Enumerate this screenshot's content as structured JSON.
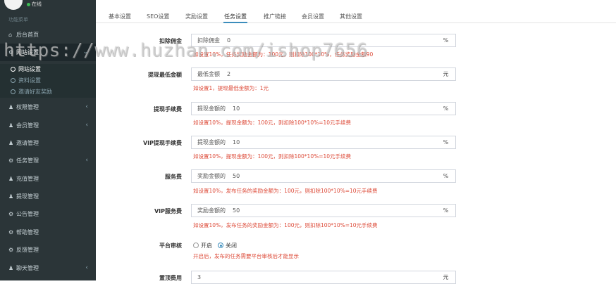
{
  "sidebar": {
    "status": "在线",
    "section_title": "功能菜单",
    "items": [
      {
        "label": "后台首页",
        "icon": "home-icon",
        "glyph": "⌂",
        "chevron": ""
      },
      {
        "label": "网站设置",
        "icon": "gears-icon",
        "glyph": "⚙",
        "chevron": "⌄"
      },
      {
        "label": "权限管理",
        "icon": "users-icon",
        "glyph": "♟",
        "chevron": "‹"
      },
      {
        "label": "会员管理",
        "icon": "users-icon",
        "glyph": "♟",
        "chevron": "‹"
      },
      {
        "label": "邀请管理",
        "icon": "users-icon",
        "glyph": "♟",
        "chevron": ""
      },
      {
        "label": "任务管理",
        "icon": "gears-icon",
        "glyph": "⚙",
        "chevron": "‹"
      },
      {
        "label": "充值管理",
        "icon": "users-icon",
        "glyph": "♟",
        "chevron": ""
      },
      {
        "label": "提现管理",
        "icon": "users-icon",
        "glyph": "♟",
        "chevron": ""
      },
      {
        "label": "公告管理",
        "icon": "gears-icon",
        "glyph": "⚙",
        "chevron": ""
      },
      {
        "label": "帮助管理",
        "icon": "gears-icon",
        "glyph": "⚙",
        "chevron": ""
      },
      {
        "label": "反馈管理",
        "icon": "gears-icon",
        "glyph": "⚙",
        "chevron": ""
      },
      {
        "label": "聊天管理",
        "icon": "users-icon",
        "glyph": "♟",
        "chevron": "‹"
      }
    ],
    "subitems": [
      {
        "label": "网站设置",
        "icon": "circle-icon"
      },
      {
        "label": "资料设置",
        "icon": "circle-icon"
      },
      {
        "label": "邀请好友奖励",
        "icon": "user-circle-icon"
      }
    ]
  },
  "tabs": [
    "基本设置",
    "SEO设置",
    "奖励设置",
    "任务设置",
    "推广链接",
    "会员设置",
    "其他设置"
  ],
  "active_tab": "任务设置",
  "form": {
    "rows": [
      {
        "label": "扣除佣金",
        "prefix": "扣除佣金",
        "value": "0",
        "unit": "%",
        "hint": "如设置10%，任务奖励金额为：100元，则扣除100*10%，任务奖励金额90"
      },
      {
        "label": "提现最低金额",
        "prefix": "最低金额",
        "value": "2",
        "unit": "元",
        "hint": "如设置1，提现最低金额为：1元"
      },
      {
        "label": "提现手续费",
        "prefix": "提现金额的",
        "value": "10",
        "unit": "%",
        "hint": "如设置10%，提现金额为：100元，则扣除100*10%=10元手续费"
      },
      {
        "label": "VIP提现手续费",
        "prefix": "提现金额的",
        "value": "10",
        "unit": "%",
        "hint": "如设置10%，提现金额为：100元，则扣除100*10%=10元手续费"
      },
      {
        "label": "服务费",
        "prefix": "奖励金额的",
        "value": "50",
        "unit": "%",
        "hint": "如设置10%，发布任务的奖励金额为：100元，则扣除100*10%=10元手续费"
      },
      {
        "label": "VIP服务费",
        "prefix": "奖励金额的",
        "value": "50",
        "unit": "%",
        "hint": "如设置10%，发布任务的奖励金额为：100元，则扣除100*10%=10元手续费"
      }
    ],
    "audit": {
      "label": "平台审核",
      "option_on": "开启",
      "option_off": "关闭",
      "selected": "关闭",
      "hint": "开启后，发布的任务需要平台审核后才能显示"
    },
    "top_fee": {
      "label": "置顶费用",
      "value": "3",
      "unit": "元"
    }
  },
  "watermark": "https://www.huzhan.com/ishop7656",
  "colors": {
    "sidebar_bg": "#2b3538",
    "accent": "#3c8dbc",
    "hint": "#dd4b39"
  }
}
